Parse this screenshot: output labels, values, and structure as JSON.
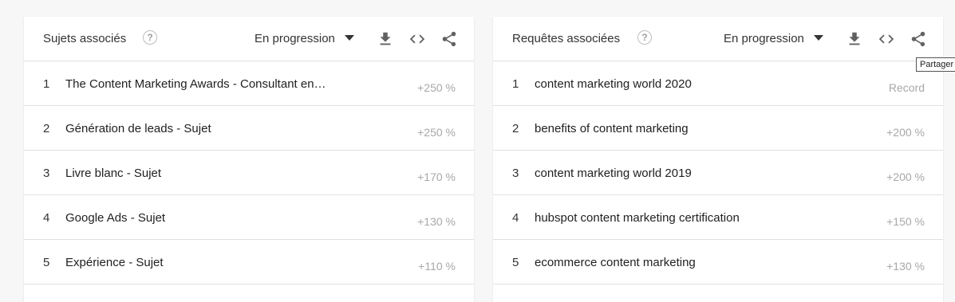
{
  "left_card": {
    "title": "Sujets associés",
    "help_icon": "help-circle-icon",
    "select_value": "En progression",
    "rows": [
      {
        "rank": "1",
        "label": "The Content Marketing Awards - Consultant en…",
        "value": "+250 %"
      },
      {
        "rank": "2",
        "label": "Génération de leads - Sujet",
        "value": "+250 %"
      },
      {
        "rank": "3",
        "label": "Livre blanc - Sujet",
        "value": "+170 %"
      },
      {
        "rank": "4",
        "label": "Google Ads - Sujet",
        "value": "+130 %"
      },
      {
        "rank": "5",
        "label": "Expérience - Sujet",
        "value": "+110 %"
      }
    ]
  },
  "right_card": {
    "title": "Requêtes associées",
    "help_icon": "help-circle-icon",
    "select_value": "En progression",
    "rows": [
      {
        "rank": "1",
        "label": "content marketing world 2020",
        "value": "Record"
      },
      {
        "rank": "2",
        "label": "benefits of content marketing",
        "value": "+200 %"
      },
      {
        "rank": "3",
        "label": "content marketing world 2019",
        "value": "+200 %"
      },
      {
        "rank": "4",
        "label": "hubspot content marketing certification",
        "value": "+150 %"
      },
      {
        "rank": "5",
        "label": "ecommerce content marketing",
        "value": "+130 %"
      }
    ]
  },
  "toolbar_icons": [
    "download-icon",
    "embed-code-icon",
    "share-icon"
  ],
  "tooltip": "Partager",
  "colors": {
    "background": "#f7f7f7",
    "card": "#ffffff",
    "divider": "#e0e0e0",
    "value_text": "#a8a8a8"
  }
}
